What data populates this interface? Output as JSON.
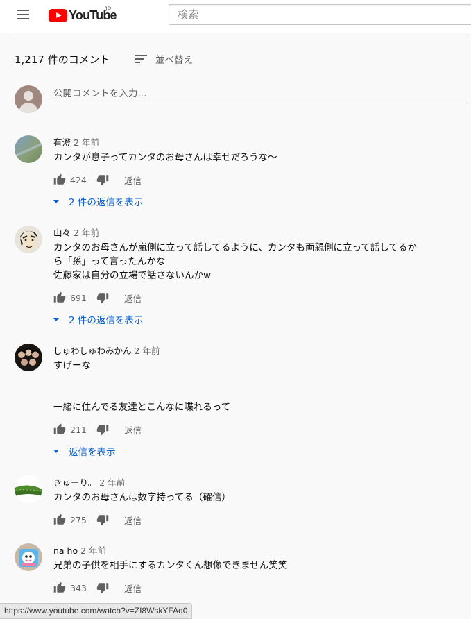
{
  "header": {
    "logo_text": "YouTube",
    "logo_region": "JP",
    "search_placeholder": "検索"
  },
  "comments_header": {
    "count_label": "1,217 件のコメント",
    "sort_label": "並べ替え"
  },
  "add_comment": {
    "placeholder": "公開コメントを入力..."
  },
  "comments": [
    {
      "author": "有澄",
      "time": "2 年前",
      "lines": [
        "カンタが息子ってカンタのお母さんは幸せだろうな〜"
      ],
      "likes": "424",
      "reply_label": "返信",
      "view_replies_label": "2 件の返信を表示"
    },
    {
      "author": "山々",
      "time": "2 年前",
      "lines": [
        "カンタのお母さんが嵐側に立って話してるように、カンタも両親側に立って話してるか",
        "ら「孫」って言ったんかな",
        "佐藤家は自分の立場で話さないんかw"
      ],
      "likes": "691",
      "reply_label": "返信",
      "view_replies_label": "2 件の返信を表示"
    },
    {
      "author": "しゅわしゅわみかん",
      "time": "2 年前",
      "lines": [
        "すげーな",
        "",
        "",
        "一緒に住んでる友達とこんなに喋れるって"
      ],
      "likes": "211",
      "reply_label": "返信",
      "view_replies_label": "返信を表示"
    },
    {
      "author": "きゅーり。",
      "time": "2 年前",
      "lines": [
        "カンタのお母さんは数字持ってる（確信）"
      ],
      "likes": "275",
      "reply_label": "返信",
      "view_replies_label": ""
    },
    {
      "author": "na ho",
      "time": "2 年前",
      "lines": [
        "兄弟の子供を相手にするカンタくん想像できません笑笑"
      ],
      "likes": "343",
      "reply_label": "返信",
      "view_replies_label": ""
    }
  ],
  "statusbar": {
    "url": "https://www.youtube.com/watch?v=ZI8WskYFAq0"
  },
  "colors": {
    "brand_red": "#ff0000",
    "link_blue": "#065fd4",
    "secondary_text": "#606060",
    "background": "#f9f9f9"
  },
  "icons": [
    "menu-icon",
    "youtube-play-icon",
    "sort-icon",
    "thumbs-up-icon",
    "thumbs-down-icon",
    "caret-down-icon"
  ]
}
